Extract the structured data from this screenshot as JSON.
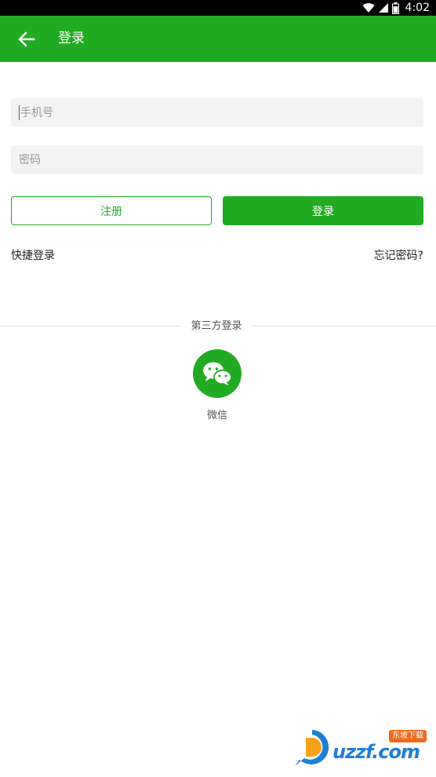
{
  "status_bar": {
    "time": "4:02",
    "icons": [
      "wifi-icon",
      "signal-icon",
      "battery-icon"
    ]
  },
  "app_bar": {
    "title": "登录",
    "back_icon": "arrow-left-icon"
  },
  "form": {
    "phone_placeholder": "手机号",
    "phone_value": "",
    "password_placeholder": "密码",
    "password_value": "",
    "register_label": "注册",
    "login_label": "登录"
  },
  "links": {
    "quick_login": "快捷登录",
    "forgot_password": "忘记密码?"
  },
  "third_party": {
    "label": "第三方登录",
    "wechat_label": "微信",
    "wechat_icon": "wechat-icon"
  },
  "watermark": {
    "brand": "uzzf.com",
    "badge": "东坡下载"
  },
  "colors": {
    "primary": "#22ab22",
    "field_bg": "#f3f3f3",
    "status_bar": "#000000"
  }
}
